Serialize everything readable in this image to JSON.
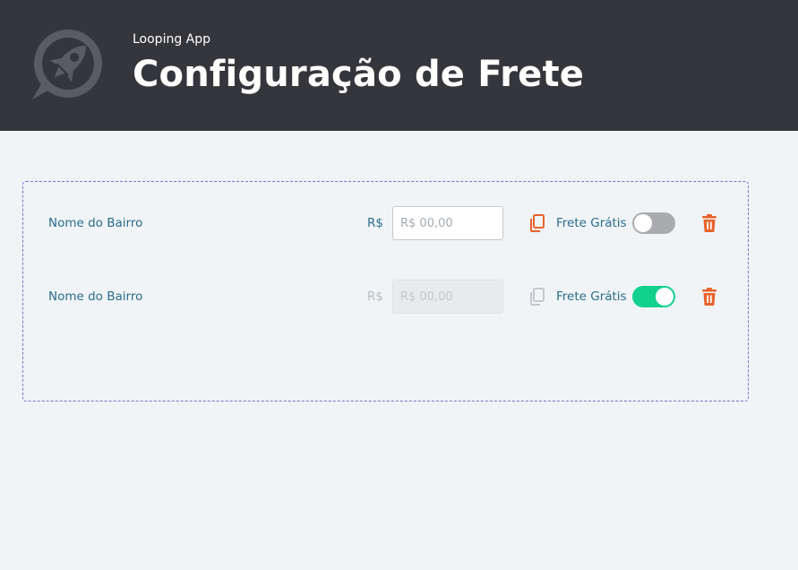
{
  "header": {
    "app_name": "Looping App",
    "title": "Configuração de Frete",
    "logo_icon": "rocket-logo-icon",
    "background_color": "#35363b"
  },
  "colors": {
    "accent_orange": "#e8632b",
    "toggle_on": "#12d18e",
    "toggle_off": "#a9abae",
    "label_blue": "#2c6c8e",
    "panel_border": "#7b6fd6"
  },
  "rows": [
    {
      "bairro_label": "Nome do Bairro",
      "currency": "R$",
      "price_placeholder": "R$ 00,00",
      "price_value": "",
      "price_disabled": false,
      "copy_icon": "copy-icon",
      "frete_label": "Frete Grátis",
      "frete_gratis": false,
      "delete_icon": "trash-icon"
    },
    {
      "bairro_label": "Nome do Bairro",
      "currency": "R$",
      "price_placeholder": "R$ 00,00",
      "price_value": "",
      "price_disabled": true,
      "copy_icon": "copy-icon",
      "frete_label": "Frete Grátis",
      "frete_gratis": true,
      "delete_icon": "trash-icon"
    }
  ]
}
